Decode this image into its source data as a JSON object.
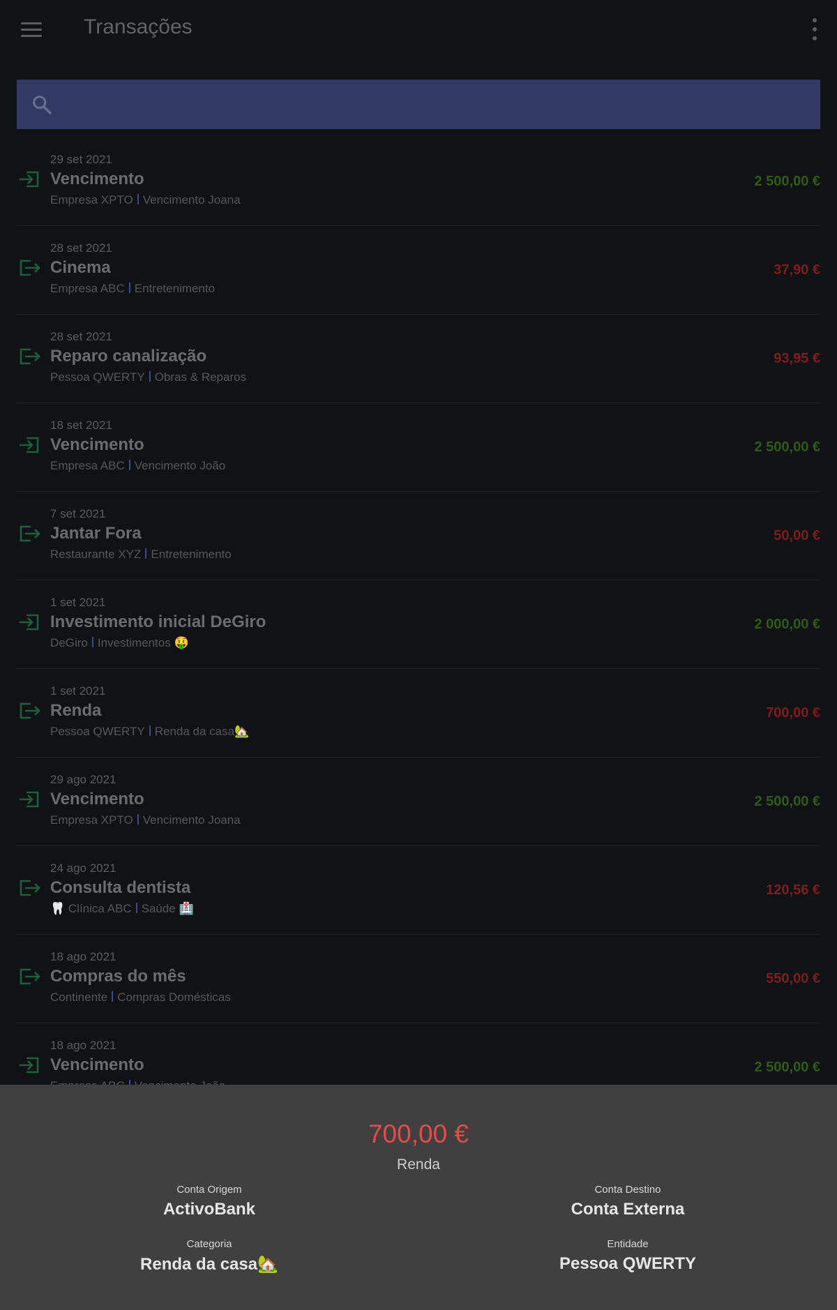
{
  "app_bar": {
    "title": "Transações",
    "menu_icon": "hamburger-menu-icon",
    "overflow_icon": "more-vert-icon"
  },
  "search": {
    "placeholder": "",
    "value": "",
    "icon": "search-icon"
  },
  "colors": {
    "income": "#2e5b16",
    "expense": "#7d1d1d",
    "sheet_amount": "#e84a4a",
    "search_bg": "#323a63",
    "sheet_bg": "#404040"
  },
  "transactions": [
    {
      "date": "29 set 2021",
      "title": "Vencimento",
      "entity": "Empresa XPTO",
      "category": "Vencimento Joana",
      "amount": "2 500,00 €",
      "type": "income"
    },
    {
      "date": "28 set 2021",
      "title": "Cinema",
      "entity": "Empresa ABC",
      "category": "Entretenimento",
      "amount": "37,90 €",
      "type": "expense"
    },
    {
      "date": "28 set 2021",
      "title": "Reparo canalização",
      "entity": "Pessoa QWERTY",
      "category": "Obras & Reparos",
      "amount": "93,95 €",
      "type": "expense"
    },
    {
      "date": "18 set 2021",
      "title": "Vencimento",
      "entity": "Empresa ABC",
      "category": "Vencimento João",
      "amount": "2 500,00 €",
      "type": "income"
    },
    {
      "date": "7 set 2021",
      "title": "Jantar Fora",
      "entity": "Restaurante XYZ",
      "category": "Entretenimento",
      "amount": "50,00 €",
      "type": "expense"
    },
    {
      "date": "1 set 2021",
      "title": "Investimento inicial DeGiro",
      "entity": "DeGiro",
      "category": "Investimentos 🤑",
      "amount": "2 000,00 €",
      "type": "income"
    },
    {
      "date": "1 set 2021",
      "title": "Renda",
      "entity": "Pessoa QWERTY",
      "category": "Renda da casa🏡",
      "amount": "700,00 €",
      "type": "expense"
    },
    {
      "date": "29 ago 2021",
      "title": "Vencimento",
      "entity": "Empresa XPTO",
      "category": "Vencimento Joana",
      "amount": "2 500,00 €",
      "type": "income"
    },
    {
      "date": "24 ago 2021",
      "title": "Consulta dentista",
      "entity": "🦷 Clínica ABC",
      "category": "Saúde 🏥",
      "amount": "120,56 €",
      "type": "expense"
    },
    {
      "date": "18 ago 2021",
      "title": "Compras do mês",
      "entity": "Continente",
      "category": "Compras Domésticas",
      "amount": "550,00 €",
      "type": "expense"
    },
    {
      "date": "18 ago 2021",
      "title": "Vencimento",
      "entity": "Empresa ABC",
      "category": "Vencimento João",
      "amount": "2 500,00 €",
      "type": "income"
    }
  ],
  "detail_sheet": {
    "amount": "700,00 €",
    "description": "Renda",
    "fields": [
      {
        "label": "Conta Origem",
        "value": "ActivoBank"
      },
      {
        "label": "Conta Destino",
        "value": "Conta Externa"
      },
      {
        "label": "Categoria",
        "value": "Renda da casa🏡"
      },
      {
        "label": "Entidade",
        "value": "Pessoa QWERTY"
      }
    ]
  }
}
